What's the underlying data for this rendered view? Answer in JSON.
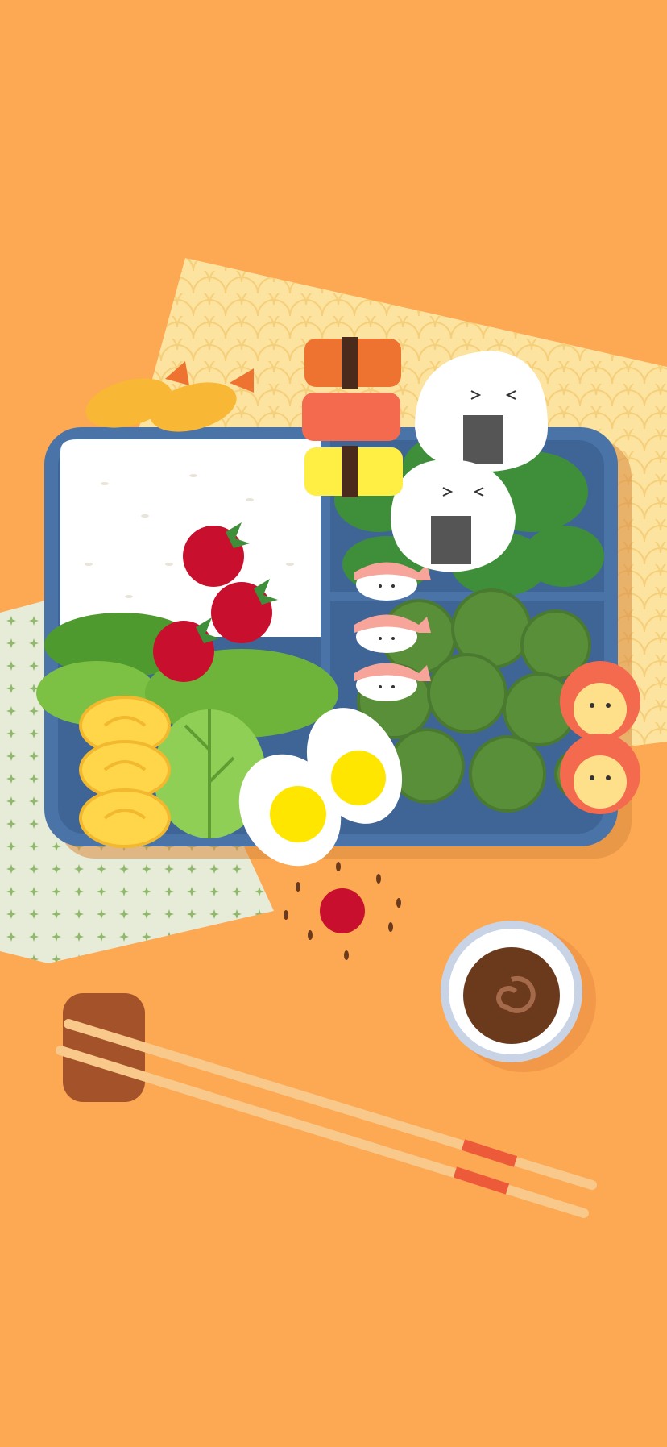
{
  "wallpaper": {
    "subject": "bento-box-illustration",
    "colors": {
      "background": "#fda853",
      "tray": "#4a74a8",
      "tray_inner": "#3f6596",
      "rice": "#ffffff",
      "tomato": "#c8102e",
      "lettuce": "#7cc143",
      "spinach": "#3f8f3a",
      "broccoli": "#5a8f3a",
      "egg_yolk": "#ffe600",
      "tamagoyaki": "#ffd54a",
      "salmon": "#f46a4e",
      "soy_sauce": "#6b3a1c",
      "chopsticks": "#f8c98a",
      "chopstick_band": "#ec5a3a",
      "placemat_yellow": "#fde3a0",
      "placemat_green": "#e6ecd8"
    },
    "items": [
      "tray",
      "rice",
      "cherry-tomatoes",
      "lettuce",
      "tamagoyaki",
      "boiled-eggs",
      "onigiri",
      "shrimp-nigiri",
      "broccoli",
      "salmon-rolls",
      "tempura-shrimp",
      "sushi-stack",
      "soy-sauce-dish",
      "chopsticks",
      "chopstick-rest"
    ]
  }
}
